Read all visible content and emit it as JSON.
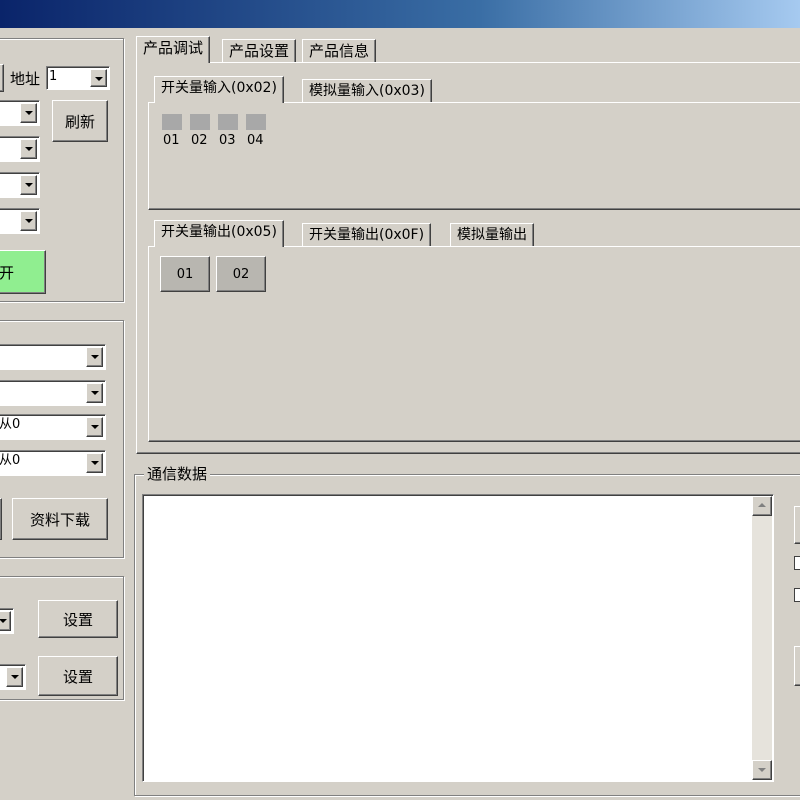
{
  "window": {
    "title": ""
  },
  "left": {
    "address_label": "地址",
    "address_value": "1",
    "refresh_label": "刷新",
    "combo2": "",
    "combo3": "",
    "combo4": "",
    "combo5": "",
    "open_label": "开",
    "combo_a": "",
    "combo_b": "",
    "combo_c": "从0",
    "combo_d": "从0",
    "download_label": "资料下载",
    "set1_label": "设置",
    "set2_label": "设置"
  },
  "main_tabs": [
    {
      "label": "产品调试"
    },
    {
      "label": "产品设置"
    },
    {
      "label": "产品信息"
    }
  ],
  "input_tabs": [
    {
      "label": "开关量输入(0x02)"
    },
    {
      "label": "模拟量输入(0x03)"
    }
  ],
  "inputs": [
    "01",
    "02",
    "03",
    "04"
  ],
  "output_tabs": [
    {
      "label": "开关量输出(0x05)"
    },
    {
      "label": "开关量输出(0x0F)"
    },
    {
      "label": "模拟量输出"
    }
  ],
  "outputs": [
    "01",
    "02"
  ],
  "comm": {
    "title": "通信数据"
  },
  "colors": {
    "led": "#a8a8a8",
    "open_button": "#90ee90",
    "titlebar": "#0a246a"
  }
}
